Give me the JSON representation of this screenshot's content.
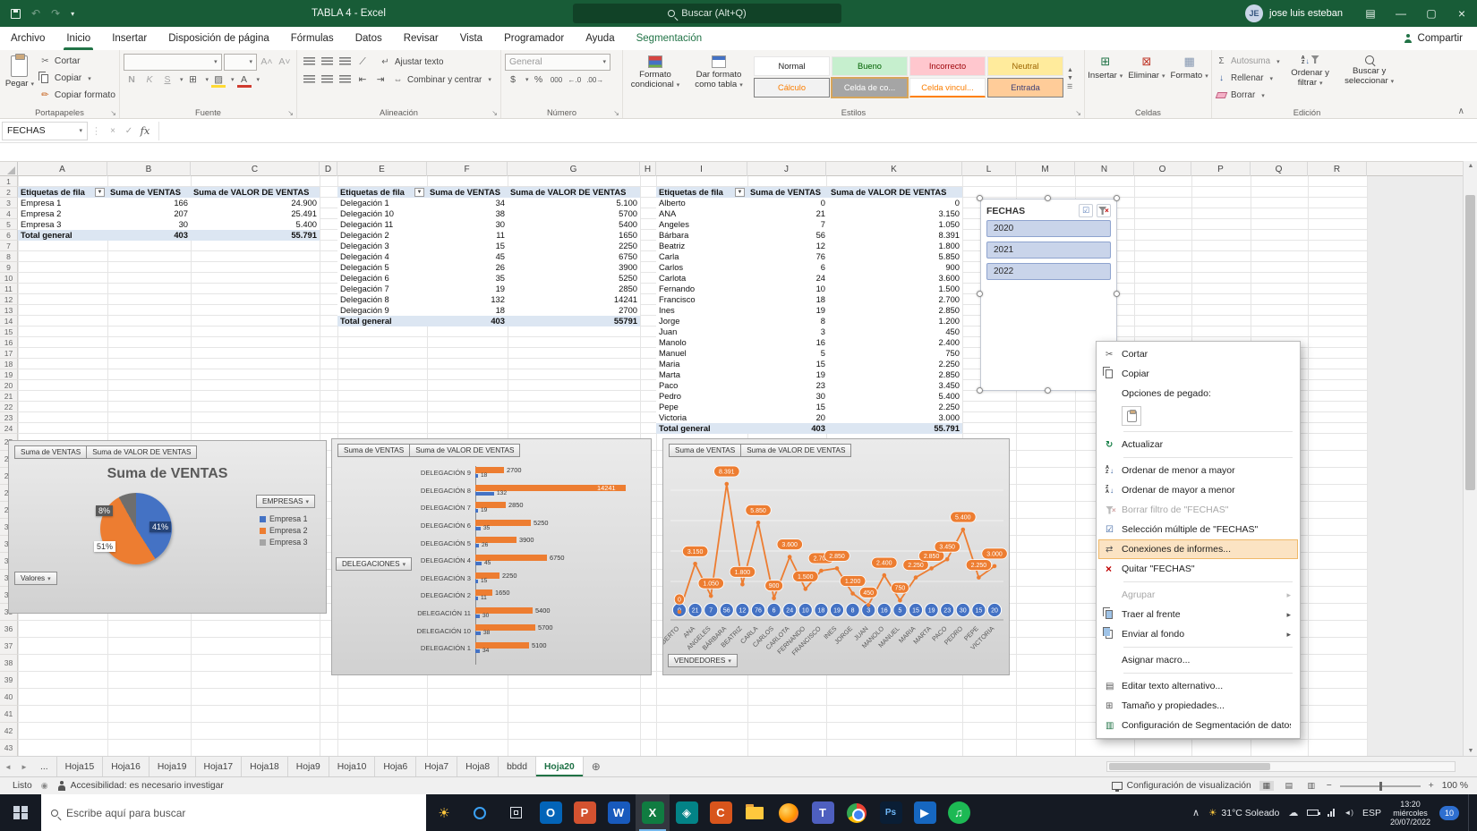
{
  "titlebar": {
    "title": "TABLA 4 - Excel",
    "search_placeholder": "Buscar (Alt+Q)",
    "user": "jose luis esteban"
  },
  "menubar": {
    "tabs": [
      {
        "label": "Archivo"
      },
      {
        "label": "Inicio",
        "active": true
      },
      {
        "label": "Insertar"
      },
      {
        "label": "Disposición de página"
      },
      {
        "label": "Fórmulas"
      },
      {
        "label": "Datos"
      },
      {
        "label": "Revisar"
      },
      {
        "label": "Vista"
      },
      {
        "label": "Programador"
      },
      {
        "label": "Ayuda"
      },
      {
        "label": "Segmentación",
        "contextual": true
      }
    ],
    "share": "Compartir"
  },
  "ribbon": {
    "clipboard": {
      "label": "Portapapeles",
      "paste": "Pegar",
      "cut": "Cortar",
      "copy": "Copiar",
      "format_painter": "Copiar formato"
    },
    "font": {
      "label": "Fuente",
      "bold": "N",
      "italic": "K",
      "underline": "S"
    },
    "alignment": {
      "label": "Alineación",
      "wrap": "Ajustar texto",
      "merge": "Combinar y centrar"
    },
    "number": {
      "label": "Número",
      "format": "General",
      "percent": "%",
      "thousands": "000"
    },
    "styles": {
      "label": "Estilos",
      "conditional": "Formato condicional",
      "as_table": "Dar formato como tabla",
      "cells": [
        {
          "label": "Normal",
          "style": "normal"
        },
        {
          "label": "Bueno",
          "style": "good"
        },
        {
          "label": "Incorrecto",
          "style": "bad"
        },
        {
          "label": "Neutral",
          "style": "neutral"
        },
        {
          "label": "Cálculo",
          "style": "calc"
        },
        {
          "label": "Celda de co...",
          "style": "check",
          "selected": true
        },
        {
          "label": "Celda vincul...",
          "style": "linked"
        },
        {
          "label": "Entrada",
          "style": "entry"
        }
      ]
    },
    "cells": {
      "label": "Celdas",
      "insert": "Insertar",
      "delete": "Eliminar",
      "format": "Formato"
    },
    "editing": {
      "label": "Edición",
      "autosum": "Autosuma",
      "fill": "Rellenar",
      "clear": "Borrar",
      "sort": "Ordenar y filtrar",
      "find": "Buscar y seleccionar"
    }
  },
  "formula_bar": {
    "name_box": "FECHAS",
    "fx": "fx"
  },
  "grid": {
    "columns": [
      "A",
      "B",
      "C",
      "D",
      "E",
      "F",
      "G",
      "H",
      "I",
      "J",
      "K",
      "L",
      "M",
      "N",
      "O",
      "P",
      "Q",
      "R"
    ],
    "rows": 43
  },
  "pivot_tables": [
    {
      "headers": [
        "Etiquetas de fila",
        "Suma de VENTAS",
        "Suma de VALOR DE VENTAS"
      ],
      "rows": [
        [
          "Empresa 1",
          "166",
          "24.900"
        ],
        [
          "Empresa 2",
          "207",
          "25.491"
        ],
        [
          "Empresa 3",
          "30",
          "5.400"
        ]
      ],
      "total": [
        "Total general",
        "403",
        "55.791"
      ]
    },
    {
      "headers": [
        "Etiquetas de fila",
        "Suma de VENTAS",
        "Suma de VALOR DE VENTAS"
      ],
      "rows": [
        [
          "Delegación 1",
          "34",
          "5.100"
        ],
        [
          "Delegación 10",
          "38",
          "5700"
        ],
        [
          "Delegación 11",
          "30",
          "5400"
        ],
        [
          "Delegación 2",
          "11",
          "1650"
        ],
        [
          "Delegación 3",
          "15",
          "2250"
        ],
        [
          "Delegación 4",
          "45",
          "6750"
        ],
        [
          "Delegación 5",
          "26",
          "3900"
        ],
        [
          "Delegación 6",
          "35",
          "5250"
        ],
        [
          "Delegación 7",
          "19",
          "2850"
        ],
        [
          "Delegación 8",
          "132",
          "14241"
        ],
        [
          "Delegación 9",
          "18",
          "2700"
        ]
      ],
      "total": [
        "Total general",
        "403",
        "55791"
      ]
    },
    {
      "headers": [
        "Etiquetas de fila",
        "Suma de VENTAS",
        "Suma de VALOR DE VENTAS"
      ],
      "rows": [
        [
          "Alberto",
          "0",
          "0"
        ],
        [
          "ANA",
          "21",
          "3.150"
        ],
        [
          "Angeles",
          "7",
          "1.050"
        ],
        [
          "Bárbara",
          "56",
          "8.391"
        ],
        [
          "Beatriz",
          "12",
          "1.800"
        ],
        [
          "Carla",
          "76",
          "5.850"
        ],
        [
          "Carlos",
          "6",
          "900"
        ],
        [
          "Carlota",
          "24",
          "3.600"
        ],
        [
          "Fernando",
          "10",
          "1.500"
        ],
        [
          "Francisco",
          "18",
          "2.700"
        ],
        [
          "Ines",
          "19",
          "2.850"
        ],
        [
          "Jorge",
          "8",
          "1.200"
        ],
        [
          "Juan",
          "3",
          "450"
        ],
        [
          "Manolo",
          "16",
          "2.400"
        ],
        [
          "Manuel",
          "5",
          "750"
        ],
        [
          "Maria",
          "15",
          "2.250"
        ],
        [
          "Marta",
          "19",
          "2.850"
        ],
        [
          "Paco",
          "23",
          "3.450"
        ],
        [
          "Pedro",
          "30",
          "5.400"
        ],
        [
          "Pepe",
          "15",
          "2.250"
        ],
        [
          "Victoria",
          "20",
          "3.000"
        ]
      ],
      "total": [
        "Total general",
        "403",
        "55.791"
      ]
    }
  ],
  "slicer": {
    "title": "FECHAS",
    "items": [
      {
        "label": "2020",
        "selected": true
      },
      {
        "label": "2021",
        "selected": true
      },
      {
        "label": "2022",
        "selected": true
      }
    ]
  },
  "context_menu": {
    "items": [
      {
        "label": "Cortar",
        "icon": "cut-icon"
      },
      {
        "label": "Copiar",
        "icon": "copy-icon"
      },
      {
        "label": "Opciones de pegado:"
      },
      {
        "type": "paste"
      },
      {
        "type": "sep"
      },
      {
        "label": "Actualizar",
        "icon": "refresh-icon"
      },
      {
        "type": "sep"
      },
      {
        "label": "Ordenar de menor a mayor",
        "icon": "sort-az-icon"
      },
      {
        "label": "Ordenar de mayor a menor",
        "icon": "sort-za-icon"
      },
      {
        "label": "Borrar filtro de \"FECHAS\"",
        "icon": "clear-filter-icon",
        "disabled": true
      },
      {
        "label": "Selección múltiple de \"FECHAS\"",
        "icon": "multi-select-icon"
      },
      {
        "label": "Conexiones de informes...",
        "icon": "report-connections-icon",
        "highlight": true
      },
      {
        "label": "Quitar \"FECHAS\"",
        "icon": "remove-icon"
      },
      {
        "type": "sep"
      },
      {
        "label": "Agrupar",
        "disabled": true,
        "submenu": true
      },
      {
        "label": "Traer al frente",
        "icon": "bring-front-icon",
        "submenu": true
      },
      {
        "label": "Enviar al fondo",
        "icon": "send-back-icon",
        "submenu": true
      },
      {
        "type": "sep"
      },
      {
        "label": "Asignar macro..."
      },
      {
        "type": "sep"
      },
      {
        "label": "Editar texto alternativo...",
        "icon": "alt-text-icon"
      },
      {
        "label": "Tamaño y propiedades...",
        "icon": "size-properties-icon"
      },
      {
        "label": "Configuración de Segmentación de datos",
        "icon": "slicer-settings-icon"
      }
    ]
  },
  "chart_data": [
    {
      "type": "pie",
      "title": "Suma de VENTAS",
      "field_buttons": [
        "Suma de VENTAS",
        "Suma de VALOR DE VENTAS"
      ],
      "filter_button": "EMPRESAS",
      "axis_button": "Valores",
      "legend": [
        {
          "label": "Empresa 1",
          "color": "#4472C4"
        },
        {
          "label": "Empresa 2",
          "color": "#ED7D31"
        },
        {
          "label": "Empresa 3",
          "color": "#A5A5A5"
        }
      ],
      "slices": [
        {
          "label": "Empresa 1",
          "pct": 41,
          "text": "41%",
          "color": "#4472C4"
        },
        {
          "label": "Empresa 2",
          "pct": 51,
          "text": "51%",
          "color": "#ED7D31"
        },
        {
          "label": "Empresa 3",
          "pct": 8,
          "text": "8%",
          "color": "#6E6E6E"
        }
      ]
    },
    {
      "type": "bar",
      "orientation": "horizontal",
      "field_buttons": [
        "Suma de VENTAS",
        "Suma de VALOR DE VENTAS"
      ],
      "axis_button": "DELEGACIONES",
      "categories": [
        "DELEGACIÓN 9",
        "DELEGACIÓN 8",
        "DELEGACIÓN 7",
        "DELEGACIÓN 6",
        "DELEGACIÓN 5",
        "DELEGACIÓN 4",
        "DELEGACIÓN 3",
        "DELEGACIÓN 2",
        "DELEGACIÓN 11",
        "DELEGACIÓN 10",
        "DELEGACIÓN 1"
      ],
      "series": [
        {
          "name": "Suma de VENTAS",
          "color": "#4472C4",
          "values": [
            18,
            132,
            19,
            35,
            26,
            45,
            15,
            11,
            30,
            38,
            34
          ]
        },
        {
          "name": "Suma de VALOR DE VENTAS",
          "color": "#ED7D31",
          "values": [
            2700,
            14241,
            2850,
            5250,
            3900,
            6750,
            2250,
            1650,
            5400,
            5700,
            5100
          ]
        }
      ],
      "xmax": 14241
    },
    {
      "type": "line",
      "field_buttons": [
        "Suma de VENTAS",
        "Suma de VALOR DE VENTAS"
      ],
      "axis_button": "VENDEDORES",
      "categories": [
        "ALBERTO",
        "ANA",
        "ANGELES",
        "BÁRBARA",
        "BEATRIZ",
        "CARLA",
        "CARLOS",
        "CARLOTA",
        "FERNANDO",
        "FRANCISCO",
        "INES",
        "JORGE",
        "JUAN",
        "MANOLO",
        "MANUEL",
        "MARIA",
        "MARTA",
        "PACO",
        "PEDRO",
        "PEPE",
        "VICTORIA"
      ],
      "series": [
        {
          "name": "Suma de VENTAS",
          "color": "#4472C4",
          "values": [
            0,
            21,
            7,
            56,
            12,
            76,
            6,
            24,
            10,
            18,
            19,
            8,
            3,
            16,
            5,
            15,
            19,
            23,
            30,
            15,
            20
          ],
          "labels": [
            "0",
            "21",
            "7",
            "56",
            "12",
            "76",
            "6",
            "24",
            "10",
            "18",
            "19",
            "8",
            "3",
            "16",
            "5",
            "15",
            "19",
            "23",
            "30",
            "15",
            "20"
          ]
        },
        {
          "name": "Suma de VALOR DE VENTAS",
          "color": "#ED7D31",
          "values": [
            0,
            3150,
            1050,
            8391,
            1800,
            5850,
            900,
            3600,
            1500,
            2700,
            2850,
            1200,
            450,
            2400,
            750,
            2250,
            2850,
            3450,
            5400,
            2250,
            3000
          ],
          "labels": [
            "0",
            "3.150",
            "1.050",
            "8.391",
            "1.800",
            "5.850",
            "900",
            "3.600",
            "1.500",
            "2.700",
            "2.850",
            "1.200",
            "450",
            "2.400",
            "750",
            "2.250",
            "2.850",
            "3.450",
            "5.400",
            "2.250",
            "3.000"
          ]
        }
      ],
      "ymax": 8800
    }
  ],
  "sheet_tabs": {
    "overflow": "...",
    "tabs": [
      "Hoja15",
      "Hoja16",
      "Hoja19",
      "Hoja17",
      "Hoja18",
      "Hoja9",
      "Hoja10",
      "Hoja6",
      "Hoja7",
      "Hoja8",
      "bbdd",
      "Hoja20"
    ],
    "active": "Hoja20"
  },
  "status_bar": {
    "mode": "Listo",
    "accessibility": "Accesibilidad: es necesario investigar",
    "display_settings": "Configuración de visualización",
    "zoom": "100 %"
  },
  "taskbar": {
    "search_placeholder": "Escribe aquí para buscar",
    "weather": "31°C Soleado",
    "lang": "ESP",
    "time": "13:20",
    "day": "miércoles",
    "date": "20/07/2022",
    "badge": "10",
    "apps": [
      {
        "name": "outlook",
        "glyph": "O",
        "color": "#0364B8"
      },
      {
        "name": "powerpoint",
        "glyph": "P",
        "color": "#D35230"
      },
      {
        "name": "word",
        "glyph": "W",
        "color": "#185ABD"
      },
      {
        "name": "excel",
        "glyph": "X",
        "color": "#107C41",
        "active": true
      },
      {
        "name": "app-teal",
        "glyph": "◈",
        "color": "#038387"
      },
      {
        "name": "app-capture",
        "glyph": "C",
        "color": "#D8551C"
      },
      {
        "name": "file-explorer",
        "glyph": "",
        "color": "#FFC83D"
      },
      {
        "name": "firefox",
        "glyph": "",
        "color": "#FF9500"
      },
      {
        "name": "teams",
        "glyph": "T",
        "color": "#4E5FBF"
      },
      {
        "name": "chrome",
        "glyph": "",
        "color": "#4285F4"
      },
      {
        "name": "photoshop",
        "glyph": "Ps",
        "color": "#0A1E35"
      },
      {
        "name": "app-blue",
        "glyph": "▶",
        "color": "#1667C0"
      },
      {
        "name": "spotify",
        "glyph": "♫",
        "color": "#1DB954"
      }
    ]
  }
}
